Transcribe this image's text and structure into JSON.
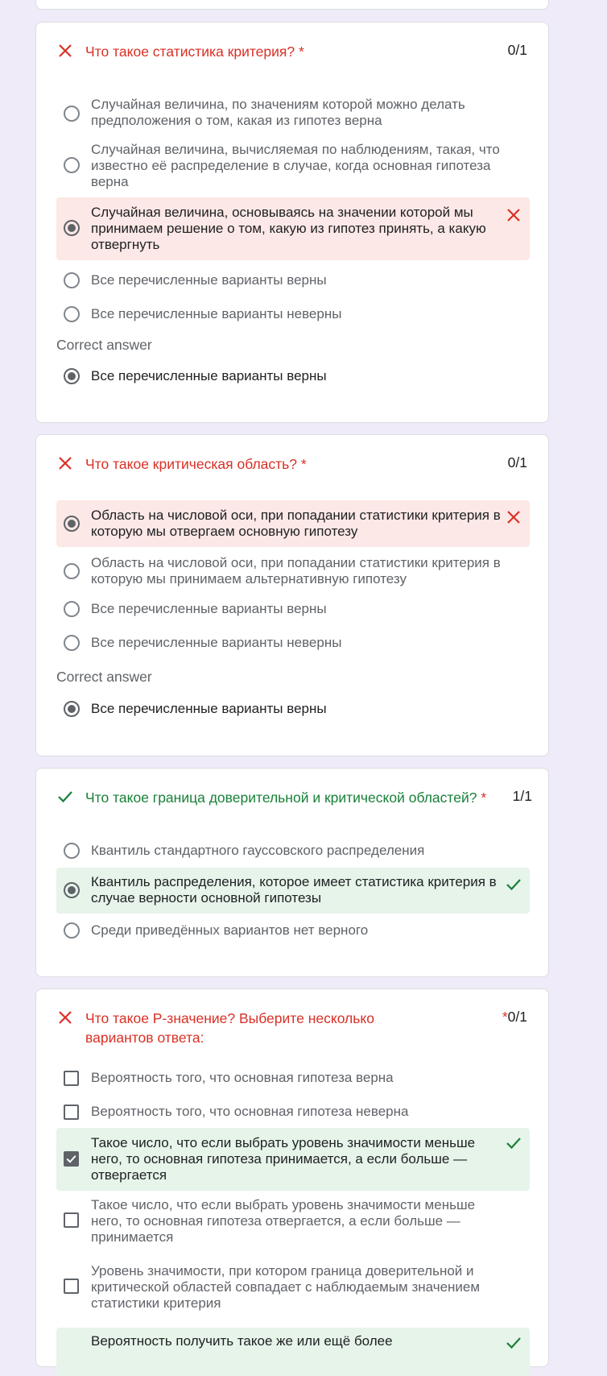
{
  "colors": {
    "wrong": "#d93025",
    "right": "#188038",
    "wrong_bg": "#fce8e6",
    "right_bg": "#e6f4ea"
  },
  "questions": [
    {
      "title": "Что такое статистика критерия?",
      "required_mark": "*",
      "score": "0/1",
      "status": "wrong",
      "options": [
        "Случайная величина, по значениям которой можно делать предположения о том, какая из гипотез верна",
        "Случайная величина, вычисляемая по наблюдениям, такая, что известно её распределение в случае, когда основная гипотеза верна",
        "Случайная величина, основываясь на значении которой мы принимаем решение о том, какую из гипотез принять, а какую отвергнуть",
        "Все перечисленные варианты верны",
        "Все перечисленные варианты неверны"
      ],
      "selected_index": 2,
      "correct_label": "Correct answer",
      "correct_answer": "Все перечисленные варианты верны"
    },
    {
      "title": "Что такое критическая область?",
      "required_mark": "*",
      "score": "0/1",
      "status": "wrong",
      "options": [
        "Область на числовой оси, при попадании статистики критерия в которую мы отвергаем основную гипотезу",
        "Область на числовой оси, при попадании статистики критерия в которую мы принимаем альтернативную гипотезу",
        "Все перечисленные варианты верны",
        "Все перечисленные варианты неверны"
      ],
      "selected_index": 0,
      "correct_label": "Correct answer",
      "correct_answer": "Все перечисленные варианты верны"
    },
    {
      "title": "Что такое граница доверительной и критической областей?",
      "required_mark": "*",
      "score": "1/1",
      "status": "right",
      "options": [
        "Квантиль стандартного гауссовского распределения",
        "Квантиль распределения, которое имеет статистика критерия в случае верности основной гипотезы",
        "Среди приведённых вариантов нет верного"
      ],
      "selected_index": 1
    },
    {
      "title": "Что такое P-значение? Выберите несколько вариантов ответа:",
      "required_mark": "*",
      "score": "0/1",
      "status": "wrong",
      "options": [
        "Вероятность того, что основная гипотеза верна",
        "Вероятность того, что основная гипотеза неверна",
        "Такое число, что если выбрать уровень значимости меньше него, то основная гипотеза принимается, а если больше — отвергается",
        "Такое число, что если выбрать уровень значимости меньше него, то основная гипотеза отвергается, а если больше — принимается",
        "Уровень значимости, при котором граница доверительной и критической областей совпадает с наблюдаемым значением статистики критерия",
        "Вероятность получить такое же или ещё более"
      ],
      "checked_indices": [
        2,
        5
      ]
    }
  ]
}
